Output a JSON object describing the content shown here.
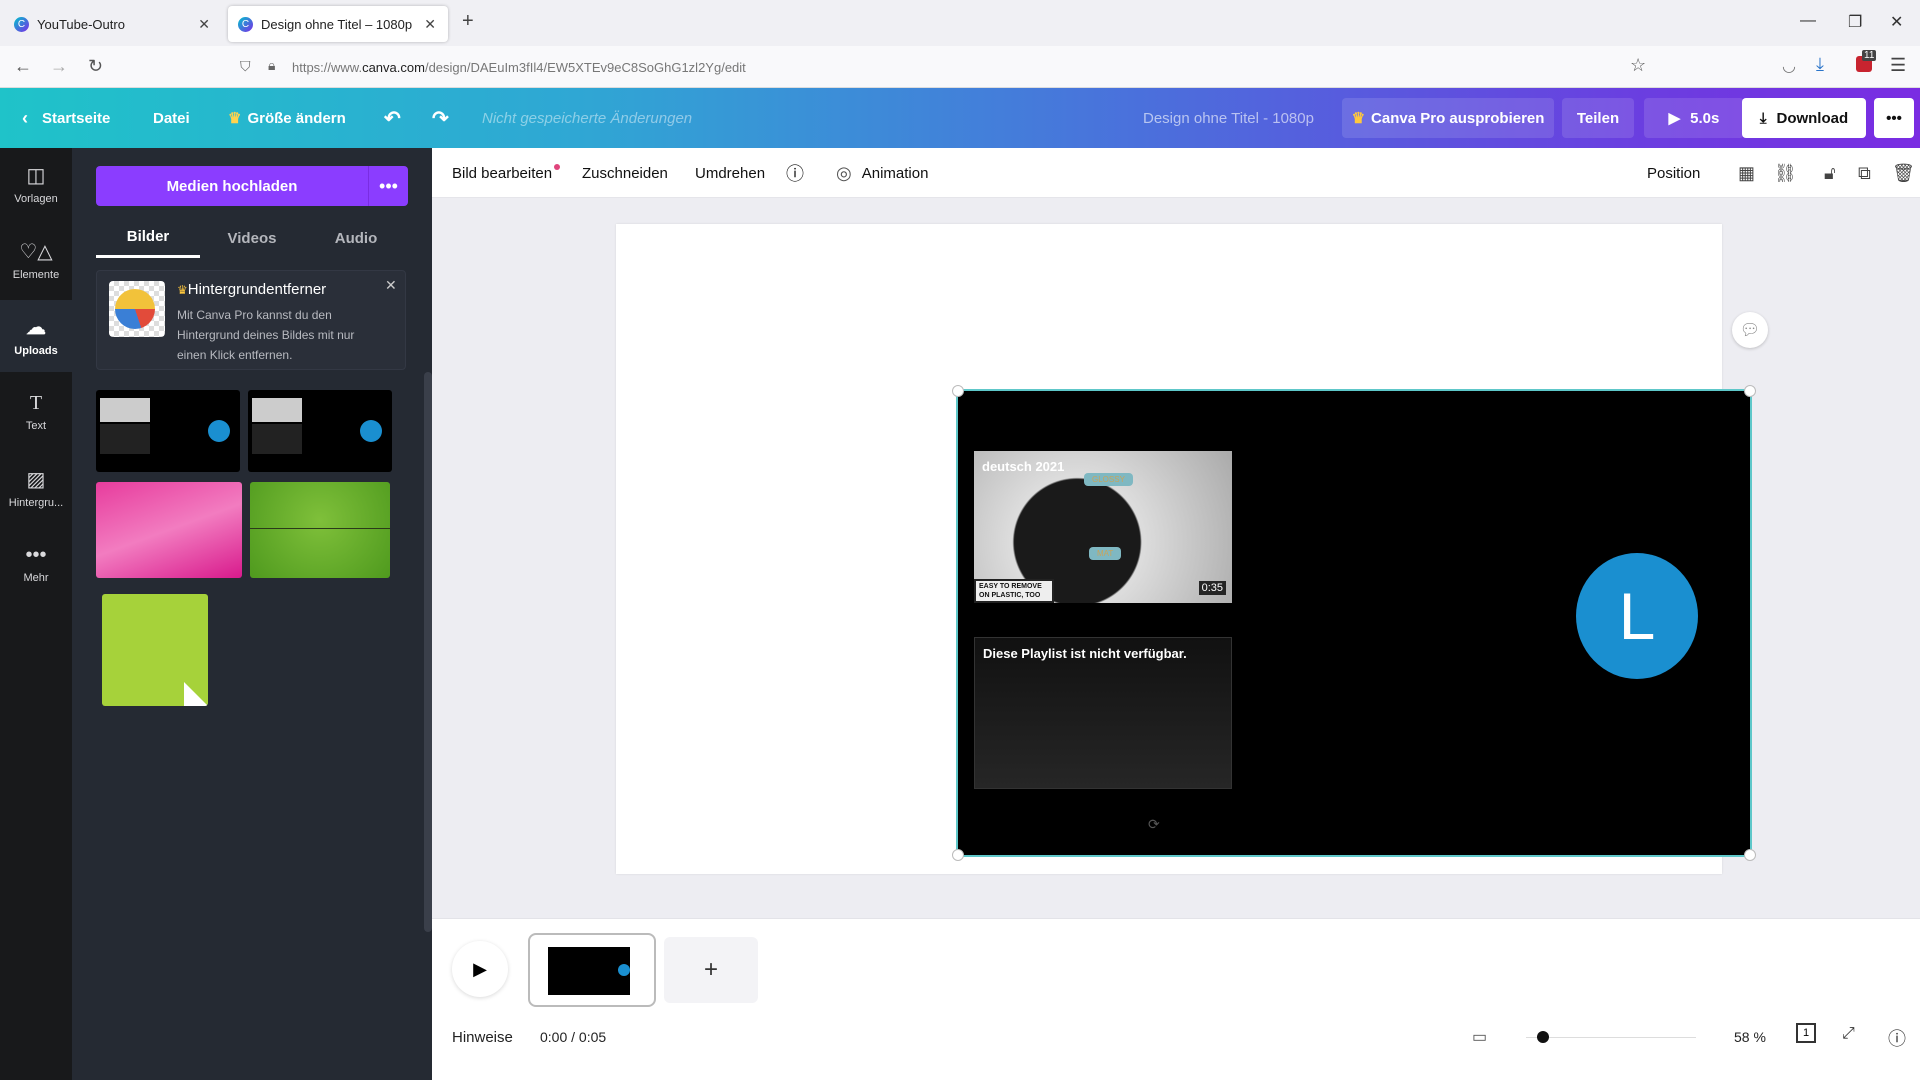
{
  "browser": {
    "tabs": [
      {
        "title": "YouTube-Outro",
        "active": false
      },
      {
        "title": "Design ohne Titel – 1080p",
        "active": true
      }
    ],
    "new_tab_label": "+",
    "url_prefix": "https://www.",
    "url_domain": "canva.com",
    "url_path": "/design/DAEuIm3fIl4/EW5XTEv9eC8SoGhG1zl2Yg/edit",
    "extension_badge": "11"
  },
  "header": {
    "home": "Startseite",
    "file": "Datei",
    "resize": "Größe ändern",
    "save_status": "Nicht gespeicherte Änderungen",
    "design_title": "Design ohne Titel - 1080p",
    "pro": "Canva Pro ausprobieren",
    "share": "Teilen",
    "play_duration": "5.0s",
    "download": "Download",
    "more": "•••"
  },
  "rail": [
    {
      "label": "Vorlagen",
      "icon": "template-icon"
    },
    {
      "label": "Elemente",
      "icon": "elements-icon"
    },
    {
      "label": "Uploads",
      "icon": "upload-cloud-icon",
      "active": true
    },
    {
      "label": "Text",
      "icon": "text-icon"
    },
    {
      "label": "Hintergru...",
      "icon": "background-icon"
    },
    {
      "label": "Mehr",
      "icon": "more-icon"
    }
  ],
  "panel": {
    "upload_button": "Medien hochladen",
    "upload_more": "•••",
    "tabs": [
      "Bilder",
      "Videos",
      "Audio"
    ],
    "active_tab": "Bilder",
    "promo": {
      "title": "Hintergrundentferner",
      "body": "Mit Canva Pro kannst du den Hintergrund deines Bildes mit nur einen Klick entfernen."
    }
  },
  "toolbar": {
    "edit_image": "Bild bearbeiten",
    "crop": "Zuschneiden",
    "flip": "Umdrehen",
    "animation": "Animation",
    "position": "Position"
  },
  "design": {
    "video_title": "deutsch 2021",
    "video_caption_line1": "EASY TO REMOVE",
    "video_caption_line2": "ON PLASTIC, TOO",
    "video_label_top": "GLOSSY",
    "video_label_bottom": "MAT",
    "video_duration": "0:35",
    "playlist_message": "Diese Playlist ist nicht verfügbar.",
    "avatar_letter": "L",
    "avatar_color": "#1a8fd0"
  },
  "bottom": {
    "notes": "Hinweise",
    "time": "0:00 / 0:05",
    "zoom": "58 %",
    "zoom_fraction": 0.1,
    "page_count": "1",
    "add_page": "+"
  }
}
